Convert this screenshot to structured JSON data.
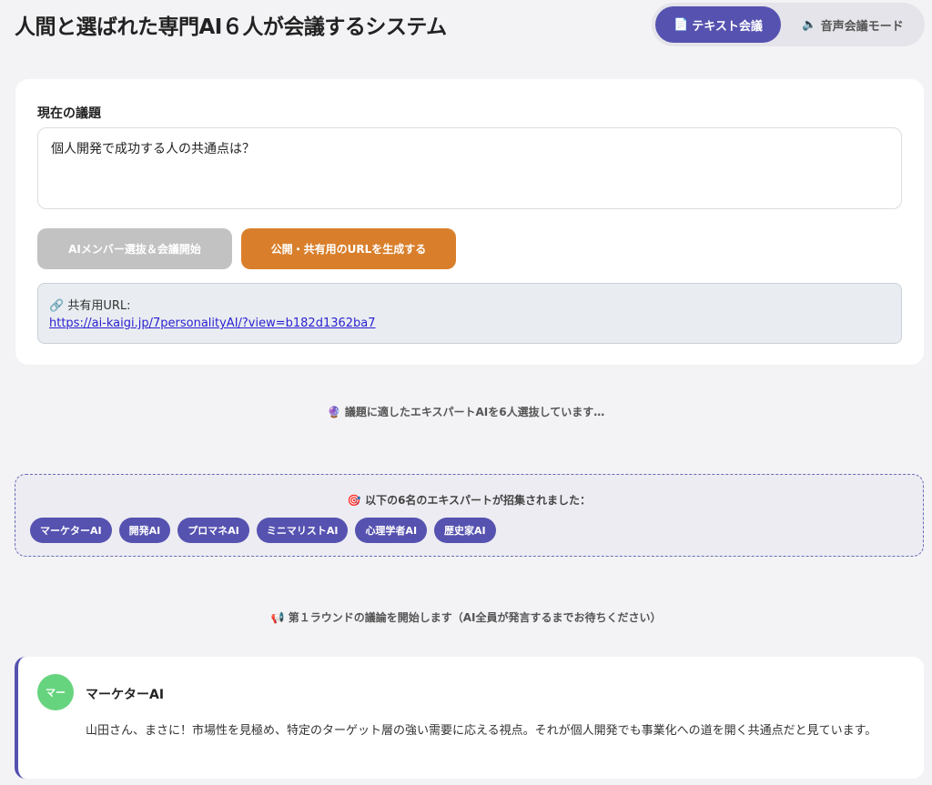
{
  "header": {
    "title": "人間と選ばれた専門AI６人が会議するシステム",
    "modes": [
      {
        "icon": "📄",
        "label": "テキスト会議",
        "active": true
      },
      {
        "icon": "🔈",
        "label": "音声会議モード",
        "active": false
      }
    ]
  },
  "topic": {
    "label": "現在の議題",
    "value": "個人開発で成功する人の共通点は？"
  },
  "actions": {
    "start_label": "AIメンバー選抜＆会議開始",
    "share_label": "公開・共有用のURLを生成する"
  },
  "share": {
    "icon": "🔗",
    "label": "共有用URL:",
    "url": "https://ai-kaigi.jp/7personalityAI/?view=b182d1362ba7"
  },
  "status": {
    "selecting_icon": "🔮",
    "selecting": "議題に適したエキスパートAIを6人選抜しています…",
    "recruited_icon": "🎯",
    "recruited_title": "以下の6名のエキスパートが招集されました：",
    "members": [
      "マーケターAI",
      "開発AI",
      "プロマネAI",
      "ミニマリストAI",
      "心理学者AI",
      "歴史家AI"
    ],
    "round_icon": "📢",
    "round": "第１ラウンドの議論を開始します（AI全員が発言するまでお待ちください）"
  },
  "messages": [
    {
      "avatar": "マー",
      "avatar_color": "#66d47e",
      "speaker": "マーケターAI",
      "text": "山田さん、まさに！市場性を見極め、特定のターゲット層の強い需要に応える視点。それが個人開発でも事業化への道を開く共通点だと見ています。"
    }
  ],
  "colors": {
    "accent": "#5652b0",
    "share_button": "#d97f2c",
    "disabled_button": "#c2c2c2",
    "link": "#2a1fd0"
  }
}
